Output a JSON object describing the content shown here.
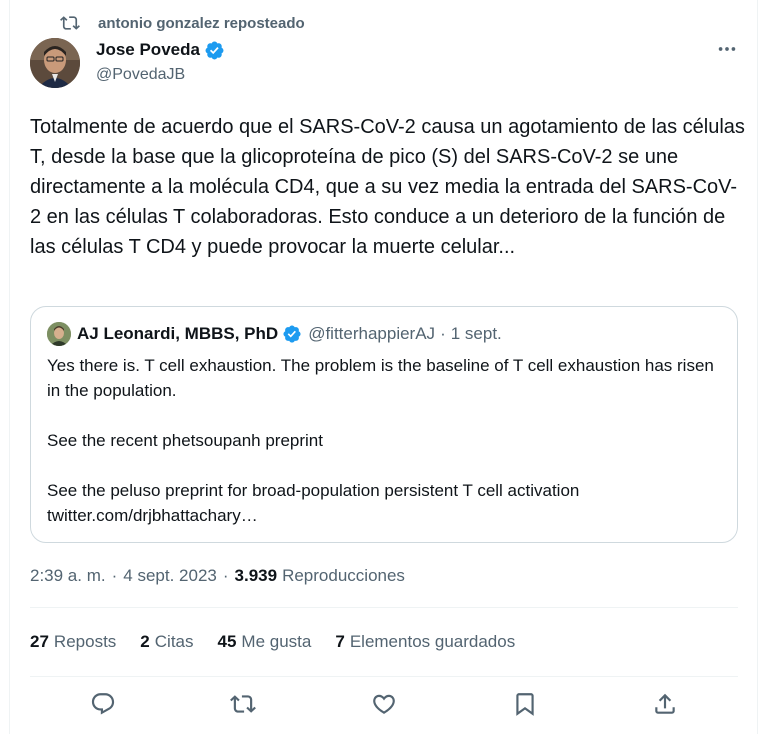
{
  "repost": {
    "label": "antonio gonzalez reposteado",
    "icon": "repost-icon"
  },
  "author": {
    "name": "Jose Poveda",
    "handle": "@PovedaJB",
    "verified": true
  },
  "tweet": {
    "text": "Totalmente de acuerdo que el SARS-CoV-2 causa un agotamiento de las células T, desde la base que la glicoproteína de pico (S) del SARS-CoV-2 se une directamente a la molécula CD4, que a su vez media la entrada del SARS-CoV-2 en las células T colaboradoras. Esto conduce a un deterioro de la función de las células T CD4 y puede provocar la muerte celular..."
  },
  "quote": {
    "name": "AJ Leonardi, MBBS, PhD",
    "handle": "@fitterhappierAJ",
    "dot": "·",
    "date": "1 sept.",
    "paragraphs": [
      "Yes there is. T cell exhaustion. The problem is the baseline of T cell exhaustion has risen in the population.",
      "See the recent phetsoupanh preprint",
      "See the peluso preprint for broad-population persistent T cell activation twitter.com/drjbhattachary…"
    ]
  },
  "meta": {
    "time": "2:39 a. m.",
    "sep1": "·",
    "date": "4 sept. 2023",
    "sep2": "·",
    "views": "3.939",
    "views_label": "Reproducciones"
  },
  "stats": [
    {
      "num": "27",
      "label": "Reposts"
    },
    {
      "num": "2",
      "label": "Citas"
    },
    {
      "num": "45",
      "label": "Me gusta"
    },
    {
      "num": "7",
      "label": "Elementos guardados"
    }
  ],
  "actions": [
    "reply-icon",
    "repost-icon",
    "like-icon",
    "bookmark-icon",
    "share-icon"
  ],
  "colors": {
    "verified": "#1d9bf0",
    "secondary_text": "#536471",
    "primary_text": "#0f1419",
    "border": "#cfd9de"
  }
}
